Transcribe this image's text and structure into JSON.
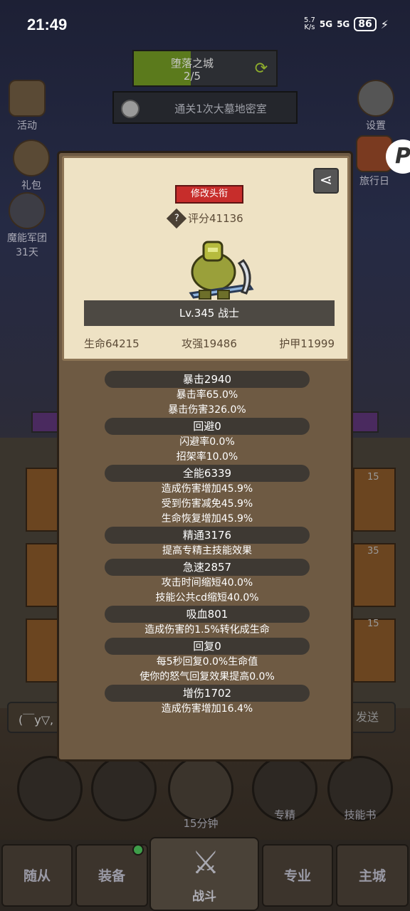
{
  "status_bar": {
    "time": "21:49",
    "net_speed_top": "5.7",
    "net_speed_unit": "K/s",
    "signal1": "5G",
    "signal2": "5G",
    "battery": "86"
  },
  "quest": {
    "name": "堕落之城",
    "progress": "2/5",
    "progress_fraction": 0.4,
    "task": "通关1次大墓地密室"
  },
  "side_menu": {
    "activity": "活动",
    "gift": "礼包",
    "corps_name": "魔能军团",
    "corps_days": "31天",
    "settings": "设置",
    "travel": "旅行日"
  },
  "profile": {
    "edit_title_label": "修改头衔",
    "score": "评分41136",
    "level_class": "Lv.345 战士",
    "hp": "生命64215",
    "attack": "攻强19486",
    "armor": "护甲11999"
  },
  "stats": [
    {
      "header": "暴击2940",
      "lines": [
        "暴击率65.0%",
        "暴击伤害326.0%"
      ]
    },
    {
      "header": "回避0",
      "lines": [
        "闪避率0.0%",
        "招架率10.0%"
      ]
    },
    {
      "header": "全能6339",
      "lines": [
        "造成伤害增加45.9%",
        "受到伤害减免45.9%",
        "生命恢复增加45.9%"
      ]
    },
    {
      "header": "精通3176",
      "lines": [
        "提高专精主技能效果"
      ]
    },
    {
      "header": "急速2857",
      "lines": [
        "攻击时间缩短40.0%",
        "技能公共cd缩短40.0%"
      ]
    },
    {
      "header": "吸血801",
      "lines": [
        "造成伤害的1.5%转化成生命"
      ]
    },
    {
      "header": "回复0",
      "lines": [
        "每5秒回复0.0%生命值",
        "使你的怒气回复效果提高0.0%"
      ]
    },
    {
      "header": "增伤1702",
      "lines": [
        "造成伤害增加16.4%"
      ]
    }
  ],
  "chat": {
    "text": "(￣y▽,",
    "send": "发送"
  },
  "round_buttons": {
    "timer": "15分钟",
    "specialization": "专精",
    "skill_book": "技能书"
  },
  "bottom_nav": {
    "followers": "随从",
    "equipment": "装备",
    "battle": "战斗",
    "profession": "专业",
    "main_city": "主城"
  },
  "bg_card_levels": [
    "15",
    "35",
    "15"
  ],
  "colors": {
    "title_button": "#c72d2b",
    "card_bg": "#eee2c4",
    "dialog_bg": "#6e5a43",
    "stat_header_bg": "#3e3933"
  }
}
